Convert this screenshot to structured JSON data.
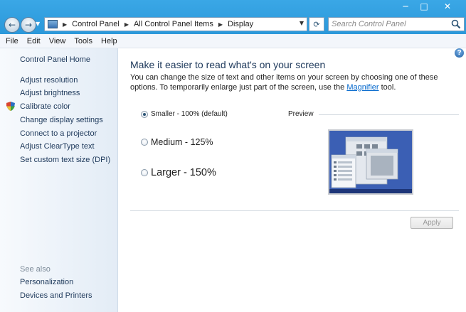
{
  "window": {
    "minimize_glyph": "─",
    "maximize_glyph": "□",
    "close_glyph": "✕"
  },
  "nav": {
    "back_glyph": "←",
    "forward_glyph": "→",
    "dropdown_glyph": "▼"
  },
  "address": {
    "icon": "control-panel-icon",
    "crumbs": [
      "Control Panel",
      "All Control Panel Items",
      "Display"
    ],
    "separator_glyph": "▶",
    "dropdown_glyph": "▼",
    "refresh_glyph": "⟳"
  },
  "search": {
    "placeholder": "Search Control Panel"
  },
  "menu": {
    "items": [
      "File",
      "Edit",
      "View",
      "Tools",
      "Help"
    ]
  },
  "sidebar": {
    "home": "Control Panel Home",
    "links": [
      "Adjust resolution",
      "Adjust brightness",
      "Calibrate color",
      "Change display settings",
      "Connect to a projector",
      "Adjust ClearType text",
      "Set custom text size (DPI)"
    ],
    "see_also_title": "See also",
    "see_also": [
      "Personalization",
      "Devices and Printers"
    ]
  },
  "content": {
    "help_glyph": "?",
    "heading": "Make it easier to read what's on your screen",
    "desc_before": "You can change the size of text and other items on your screen by choosing one of these options. To temporarily enlarge just part of the screen, use the ",
    "desc_link": "Magnifier",
    "desc_after": " tool.",
    "options": [
      {
        "label": "Smaller - 100% (default)",
        "checked": true
      },
      {
        "label": "Medium - 125%",
        "checked": false
      },
      {
        "label": "Larger - 150%",
        "checked": false
      }
    ],
    "preview_label": "Preview",
    "apply_label": "Apply"
  },
  "colors": {
    "titlebar": "#2b98da",
    "link": "#1e395b",
    "hyperlink": "#0066cc",
    "preview_bg": "#3b5fb4"
  }
}
